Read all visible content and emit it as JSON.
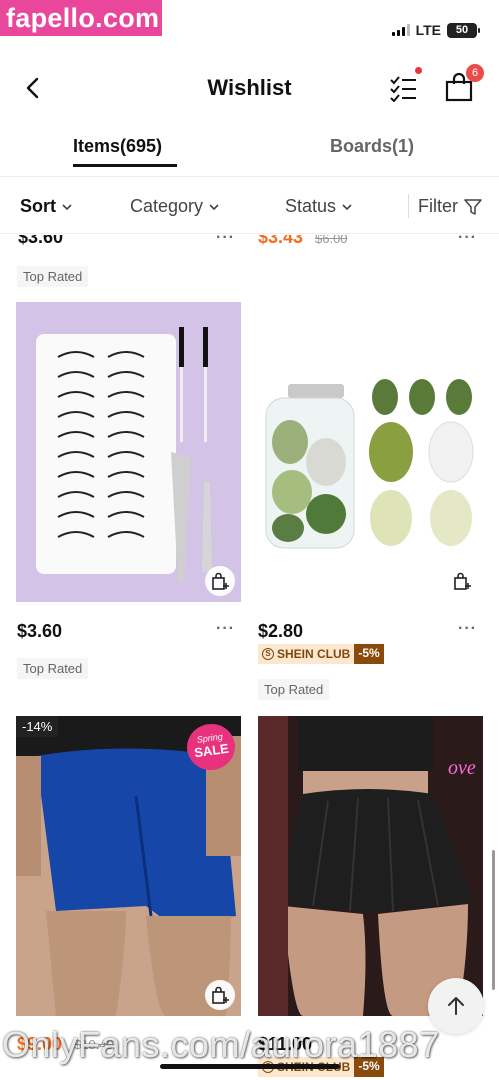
{
  "watermark_top": "fapello.com",
  "watermark_bottom": "OnlyFans.com/aurora1887",
  "status": {
    "network": "LTE",
    "battery": "50"
  },
  "header": {
    "title": "Wishlist",
    "cart_count": "6"
  },
  "tabs": {
    "items": "Items(695)",
    "boards": "Boards(1)"
  },
  "filters": {
    "sort": "Sort",
    "category": "Category",
    "status": "Status",
    "filter": "Filter"
  },
  "products": [
    {
      "price": "$3.60",
      "tag": "Top Rated"
    },
    {
      "price": "$3.43",
      "orig": "$6.00"
    },
    {
      "price": "$3.60",
      "tag": "Top Rated"
    },
    {
      "price": "$2.80",
      "club": "SHEIN CLUB",
      "club_disc": "-5%",
      "tag": "Top Rated"
    },
    {
      "price": "$9.00",
      "orig": "$10.49",
      "discount": "-14%",
      "promo_line1": "Spring",
      "promo_line2": "SALE"
    },
    {
      "price": "$11.00",
      "club": "SHEIN CLUB",
      "club_disc": "-5%"
    }
  ],
  "more_label": "···",
  "colors": {
    "accent_sale": "#f26d21",
    "badge_red": "#ea4b4b",
    "watermark_pink": "#e9479b"
  }
}
